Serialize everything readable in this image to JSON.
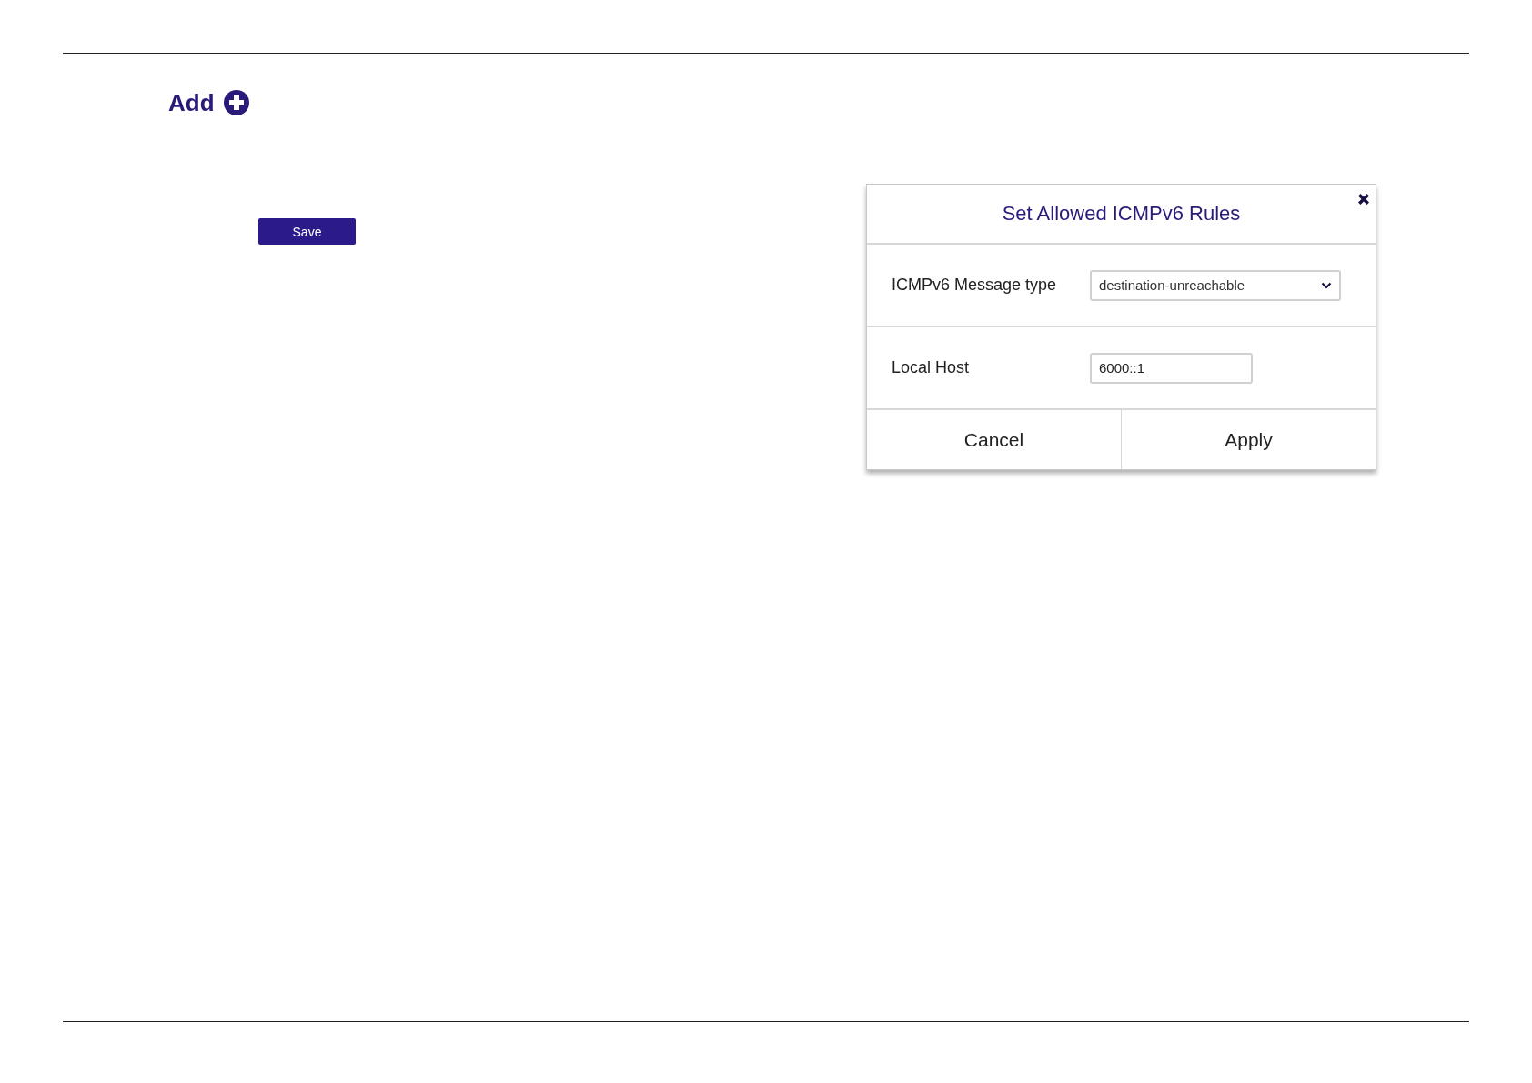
{
  "add": {
    "label": "Add"
  },
  "save_button": {
    "label": "Save"
  },
  "dialog": {
    "title": "Set Allowed ICMPv6 Rules",
    "fields": [
      {
        "kind": "select",
        "label": "ICMPv6 Message type",
        "value": "destination-unreachable"
      },
      {
        "kind": "text",
        "label": "Local Host",
        "value": "6000::1"
      }
    ],
    "buttons": [
      "Cancel",
      "Apply"
    ]
  }
}
